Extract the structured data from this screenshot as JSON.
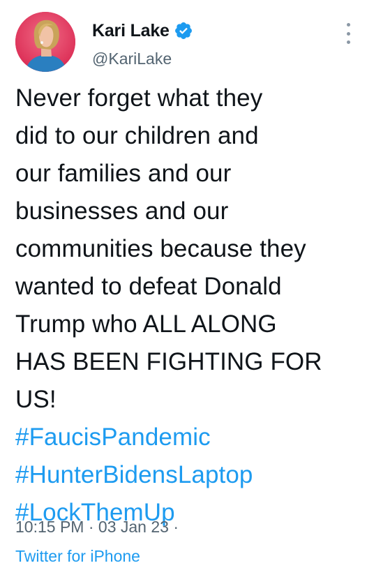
{
  "author": {
    "display_name": "Kari Lake",
    "handle": "@KariLake",
    "verified": true,
    "avatar_icon": "profile-photo-avatar"
  },
  "tweet": {
    "lines": [
      "Never forget what they",
      "did to our children and",
      "our families and our",
      "businesses and our",
      "communities because they",
      "wanted to defeat Donald",
      "Trump who ALL ALONG",
      "HAS BEEN FIGHTING FOR",
      "US!"
    ],
    "hashtags": [
      "#FaucisPandemic",
      "#HunterBidensLaptop",
      "#LockThemUp"
    ]
  },
  "meta": {
    "time": "10:15 PM",
    "separator": "·",
    "date": "03 Jan 23",
    "trailing": "·",
    "source": "Twitter for iPhone"
  },
  "colors": {
    "link_blue": "#1d9bf0",
    "text_dark": "#0f1419",
    "text_gray": "#536471",
    "avatar_bg": "#e23b63"
  },
  "icons": {
    "verified": "verified-badge-icon",
    "more": "more-options-icon"
  }
}
